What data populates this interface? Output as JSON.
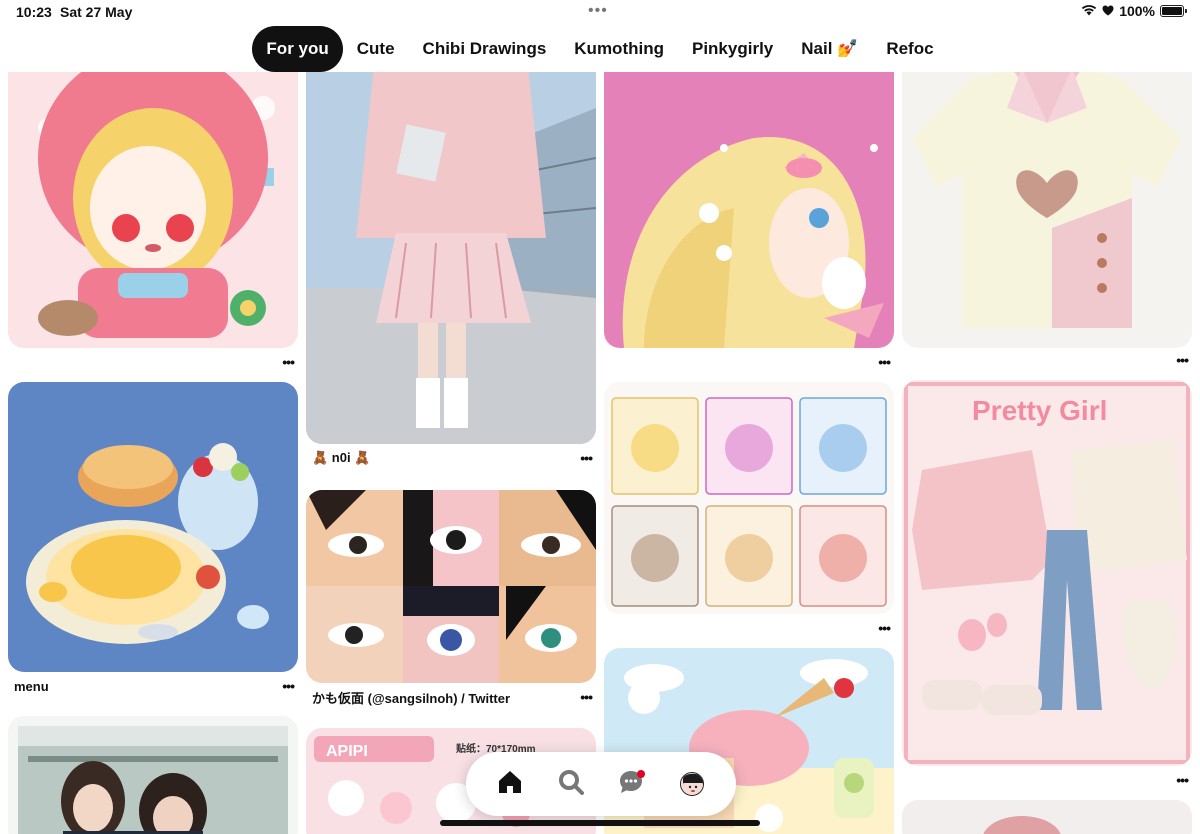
{
  "status_bar": {
    "time": "10:23",
    "date": "Sat 27 May",
    "battery": "100%",
    "battery_level": 1.0,
    "icons": [
      "wifi-icon",
      "heart-icon",
      "battery-icon"
    ]
  },
  "tabs": [
    {
      "label": "For you",
      "active": true
    },
    {
      "label": "Cute",
      "active": false
    },
    {
      "label": "Chibi Drawings",
      "active": false
    },
    {
      "label": "Kumothing",
      "active": false
    },
    {
      "label": "Pinkygirly",
      "active": false
    },
    {
      "label": "Nail 💅",
      "active": false
    },
    {
      "label": "Refoc",
      "active": false
    }
  ],
  "pins": {
    "col1_top": {
      "title": "",
      "subject": "chibi-character-illustration"
    },
    "col1_mid": {
      "title": "menu",
      "subject": "food-illustration"
    },
    "col1_bottom": {
      "title": "",
      "subject": "photo-two-girls"
    },
    "col2_top": {
      "title": "🧸 n0i 🧸",
      "subject": "pink-cardigan-outfit-photo"
    },
    "col2_mid": {
      "title": "かも仮面 (@sangsilnoh) / Twitter",
      "subject": "anime-eyes-collage"
    },
    "col2_bottom": {
      "title": "",
      "subject": "apipi-sticker-sheet"
    },
    "col3_top": {
      "title": "",
      "subject": "blonde-girl-illustration"
    },
    "col3_mid": {
      "title": "",
      "subject": "animal-hood-sketch-grid"
    },
    "col3_bottom": {
      "title": "",
      "subject": "ice-cream-illustration"
    },
    "col4_top": {
      "title": "",
      "subject": "heart-cutout-top"
    },
    "col4_mid": {
      "title": "",
      "subject": "pretty-girl-outfit",
      "overlay_text": "Pretty Girl"
    },
    "col4_bottom": {
      "title": "",
      "subject": "pink-illustration"
    }
  },
  "bottom_nav": {
    "items": [
      "home-icon",
      "search-icon",
      "messages-icon",
      "profile-avatar"
    ],
    "active": "home-icon",
    "messages_has_notification": true
  },
  "colors": {
    "active_tab_bg": "#111111",
    "notification": "#e60023"
  }
}
